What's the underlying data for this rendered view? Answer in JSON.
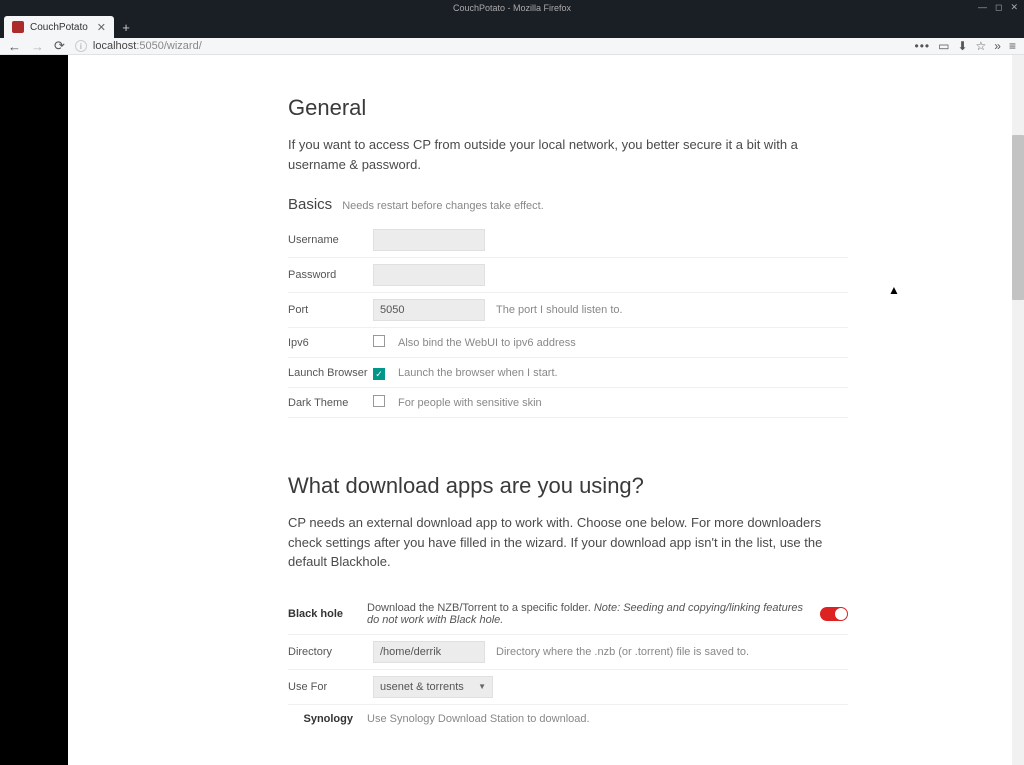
{
  "desktop": {
    "title": "CouchPotato - Mozilla Firefox"
  },
  "browser": {
    "tab": {
      "title": "CouchPotato"
    },
    "url": {
      "host": "localhost",
      "path": ":5050/wizard/"
    }
  },
  "general": {
    "heading": "General",
    "desc": "If you want to access CP from outside your local network, you better secure it a bit with a username & password.",
    "basics_label": "Basics",
    "basics_hint": "Needs restart before changes take effect.",
    "rows": {
      "username": {
        "label": "Username",
        "value": ""
      },
      "password": {
        "label": "Password",
        "value": ""
      },
      "port": {
        "label": "Port",
        "value": "5050",
        "desc": "The port I should listen to."
      },
      "ipv6": {
        "label": "Ipv6",
        "desc": "Also bind the WebUI to ipv6 address"
      },
      "launch": {
        "label": "Launch Browser",
        "desc": "Launch the browser when I start."
      },
      "dark": {
        "label": "Dark Theme",
        "desc": "For people with sensitive skin"
      }
    }
  },
  "downloaders": {
    "heading": "What download apps are you using?",
    "desc": "CP needs an external download app to work with. Choose one below. For more downloaders check settings after you have filled in the wizard. If your download app isn't in the list, use the default Blackhole.",
    "blackhole": {
      "name": "Black hole",
      "desc_pre": "Download the NZB/Torrent to a specific folder. ",
      "desc_em": "Note: Seeding and copying/linking features do not work with Black hole.",
      "directory": {
        "label": "Directory",
        "value": "/home/derrik",
        "desc": "Directory where the .nzb (or .torrent) file is saved to."
      },
      "usefor": {
        "label": "Use For",
        "value": "usenet & torrents"
      }
    },
    "synology": {
      "name": "Synology",
      "desc": "Use Synology Download Station to download."
    }
  }
}
